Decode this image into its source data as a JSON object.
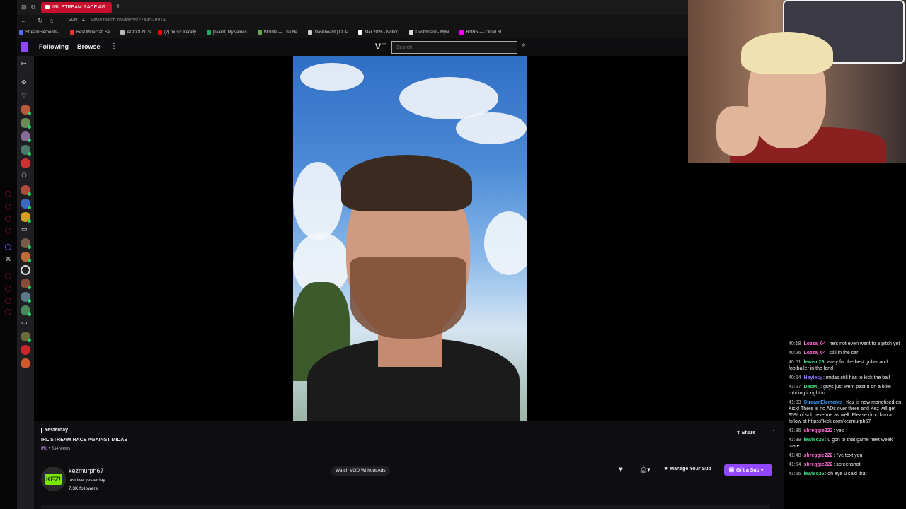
{
  "browser": {
    "tab_title": "IRL STREAM RACE AG",
    "url": "www.twitch.tv/videos/2744528974",
    "vpn_label": "VPN",
    "bookmarks": [
      {
        "label": "StreamElements -...",
        "color": "#5b6cff"
      },
      {
        "label": "Best Minecraft Se...",
        "color": "#e33"
      },
      {
        "label": "ACCOUNTS",
        "color": "#bbb"
      },
      {
        "label": "(2) music literally...",
        "color": "#f00"
      },
      {
        "label": "[Talent] MyNames...",
        "color": "#2a6"
      },
      {
        "label": "Wordle — The Ne...",
        "color": "#6aa84f"
      },
      {
        "label": "Dashboard | CLIP...",
        "color": "#ccc"
      },
      {
        "label": "Mar 2026 · Notion...",
        "color": "#fff"
      },
      {
        "label": "Dashboard - MyN...",
        "color": "#ddd"
      },
      {
        "label": "BotRix — Cloud St...",
        "color": "#f0f"
      }
    ]
  },
  "twitch_nav": {
    "following": "Following",
    "browse": "Browse",
    "search_placeholder": "Search"
  },
  "video": {
    "date": "Yesterday",
    "title": "IRL STREAM RACE AGAINST MIDAS",
    "tag": "IRL",
    "views": " • 534 views",
    "share": "Share"
  },
  "channel": {
    "name": "kezmurph67",
    "avatar_text": "KEZ!",
    "status": "last live yesterday",
    "followers": "7.3K followers",
    "watch_vod_label": "Watch VOD Without Ads",
    "manage_sub_label": "Manage Your Sub",
    "gift_sub_label": "Gift a Sub"
  },
  "chat": [
    {
      "ts": "40:18",
      "user": "Lozza_04",
      "color": "#ff6bd5",
      "text": "he's not even went to a pitch yet"
    },
    {
      "ts": "40:26",
      "user": "Lozza_04",
      "color": "#ff6bd5",
      "text": "still in the car"
    },
    {
      "ts": "40:51",
      "user": "lewisc26",
      "color": "#3ddc84",
      "text": "easy for the best golfer and footballer in the land"
    },
    {
      "ts": "40:54",
      "user": "Haylesy",
      "color": "#8a7cff",
      "text": "midas still has to kick the ball"
    },
    {
      "ts": "41:27",
      "user": "DecM_",
      "color": "#3ddc84",
      "text": "guys just went past u on a bike rubbing it right in"
    },
    {
      "ts": "41:33",
      "user": "StreamElements",
      "color": "#3aa0ff",
      "text": "Kez is now monetised on Kick! There is no ADs over there and Kez will get 95% of sub revenue as well. Please drop him a follow at https://kick.com/kezmurph67"
    },
    {
      "ts": "41:36",
      "user": "shreggie222",
      "color": "#ff6bd5",
      "text": "yes"
    },
    {
      "ts": "41:39",
      "user": "lewisc26",
      "color": "#3ddc84",
      "text": "u gon to that game next week mate"
    },
    {
      "ts": "41:48",
      "user": "shreggie222",
      "color": "#ff6bd5",
      "text": "I've text you"
    },
    {
      "ts": "41:54",
      "user": "shreggie222",
      "color": "#ff6bd5",
      "text": "screenshot"
    },
    {
      "ts": "41:55",
      "user": "lewisc26",
      "color": "#3ddc84",
      "text": "oh aye u said that"
    }
  ]
}
